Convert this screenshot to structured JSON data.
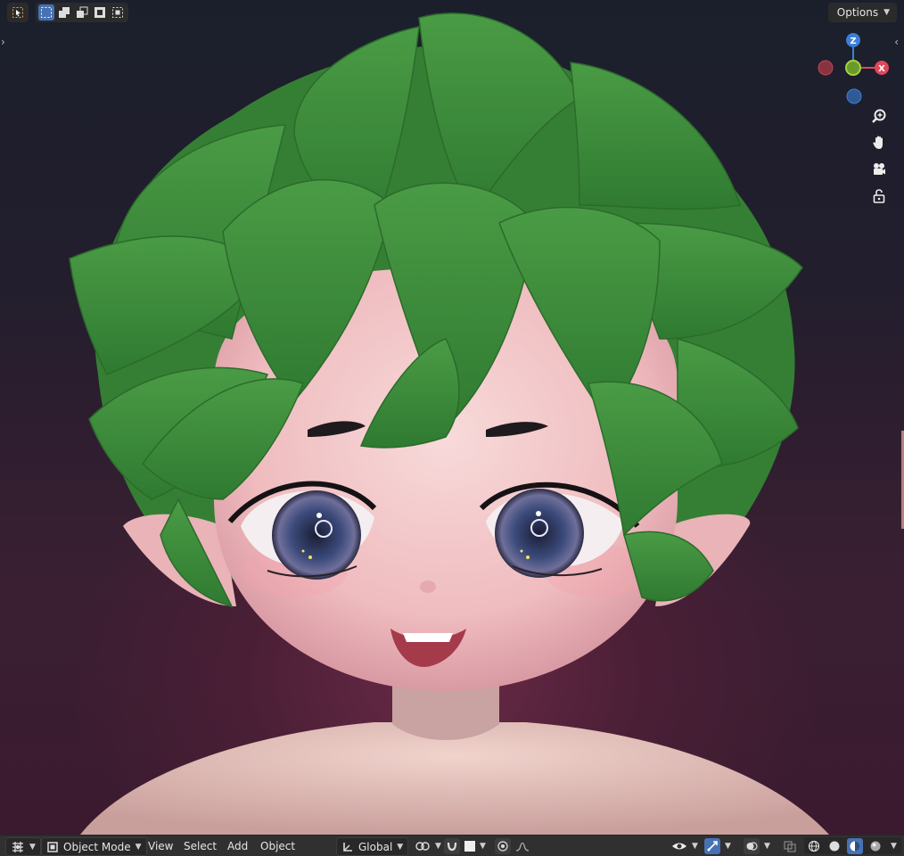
{
  "viewport": {
    "options_label": "Options",
    "gizmo": {
      "z_label": "Z",
      "x_label": "X"
    },
    "nav_icons": [
      "zoom-icon",
      "pan-hand-icon",
      "camera-icon",
      "lock-icon"
    ]
  },
  "header": {
    "select_tool_icon": "select-box-icon",
    "mode_icons": [
      "select-new-icon",
      "select-extend-icon",
      "select-subtract-icon",
      "select-invert-icon",
      "select-intersect-icon"
    ]
  },
  "footer": {
    "editor_type_icon": "object-grid-icon",
    "mode_label": "Object Mode",
    "menus": [
      "View",
      "Select",
      "Add",
      "Object"
    ],
    "transform_orientation": "Global",
    "pivot_icon": "pivot-point-icon",
    "snap_icon": "snap-magnet-icon",
    "proportional_icon": "proportional-edit-icon",
    "falloff_icon": "falloff-curve-icon",
    "visibility_icon": "eye-icon",
    "gizmo_toggle_icon": "gizmo-arrow-icon",
    "overlay_icon": "overlay-circles-icon",
    "xray_icon": "xray-icon",
    "shading_modes": [
      "wireframe",
      "solid",
      "material-preview",
      "rendered"
    ],
    "active_shading": "material-preview"
  },
  "colors": {
    "hair": "#3f8f3c",
    "skin": "#f2c6c6",
    "accent": "#4772b3",
    "axis_x": "#e2465a",
    "axis_y": "#8bbf2f",
    "axis_z": "#3b7fd6"
  }
}
